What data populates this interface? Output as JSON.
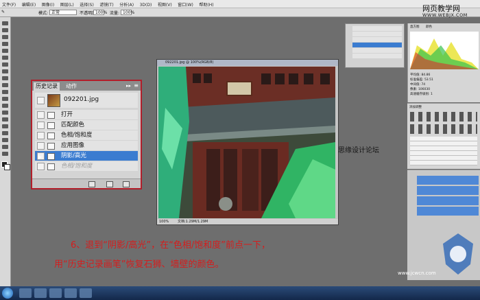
{
  "menubar": {
    "items": [
      "文件(F)",
      "编辑(E)",
      "图像(I)",
      "图层(L)",
      "选择(S)",
      "滤镜(T)",
      "分析(A)",
      "3D(D)",
      "视图(V)",
      "窗口(W)",
      "帮助(H)"
    ]
  },
  "options": {
    "mode_label": "模式:",
    "mode_value": "正常",
    "opacity_label": "不透明度:",
    "opacity_value": "100%",
    "flow_label": "流量:",
    "flow_value": "100%"
  },
  "history_panel": {
    "tabs": [
      "历史记录",
      "动作"
    ],
    "snapshot": "092201.jpg",
    "steps": [
      {
        "label": "打开",
        "state": "normal"
      },
      {
        "label": "匹配颜色",
        "state": "normal"
      },
      {
        "label": "色相/饱和度",
        "state": "normal"
      },
      {
        "label": "应用图像",
        "state": "normal"
      },
      {
        "label": "阴影/高光",
        "state": "selected"
      },
      {
        "label": "色相/饱和度",
        "state": "dimmed"
      }
    ]
  },
  "document": {
    "title": "092201.jpg @ 100%(RGB/8)",
    "zoom": "100%",
    "doc_info": "文档:1.29M/1.29M"
  },
  "histogram": {
    "title": "直方图",
    "channel": "颜色",
    "stats": [
      "平均值: 84.86",
      "标准偏差: 53.51",
      "中间值: 74",
      "像素: 106030",
      "高速缓存级别: 1"
    ]
  },
  "adjustments": {
    "title": "添加调整"
  },
  "watermark": {
    "cn": "网页教学网",
    "en": "WWW.WEBJX.COM"
  },
  "side_watermark": "思缘设计论坛",
  "caption": {
    "line1": "6、退到“阴影/高光”，在“色相/饱和度”前点一下，",
    "line2": "用“历史记录画笔”恢复石狮、墙壁的颜色。"
  },
  "brand": "www.jcwcn.com",
  "colors": {
    "accent_red": "#d51d1d",
    "selection_blue": "#3b7cd0",
    "panel_border_red": "#b21e2a"
  }
}
